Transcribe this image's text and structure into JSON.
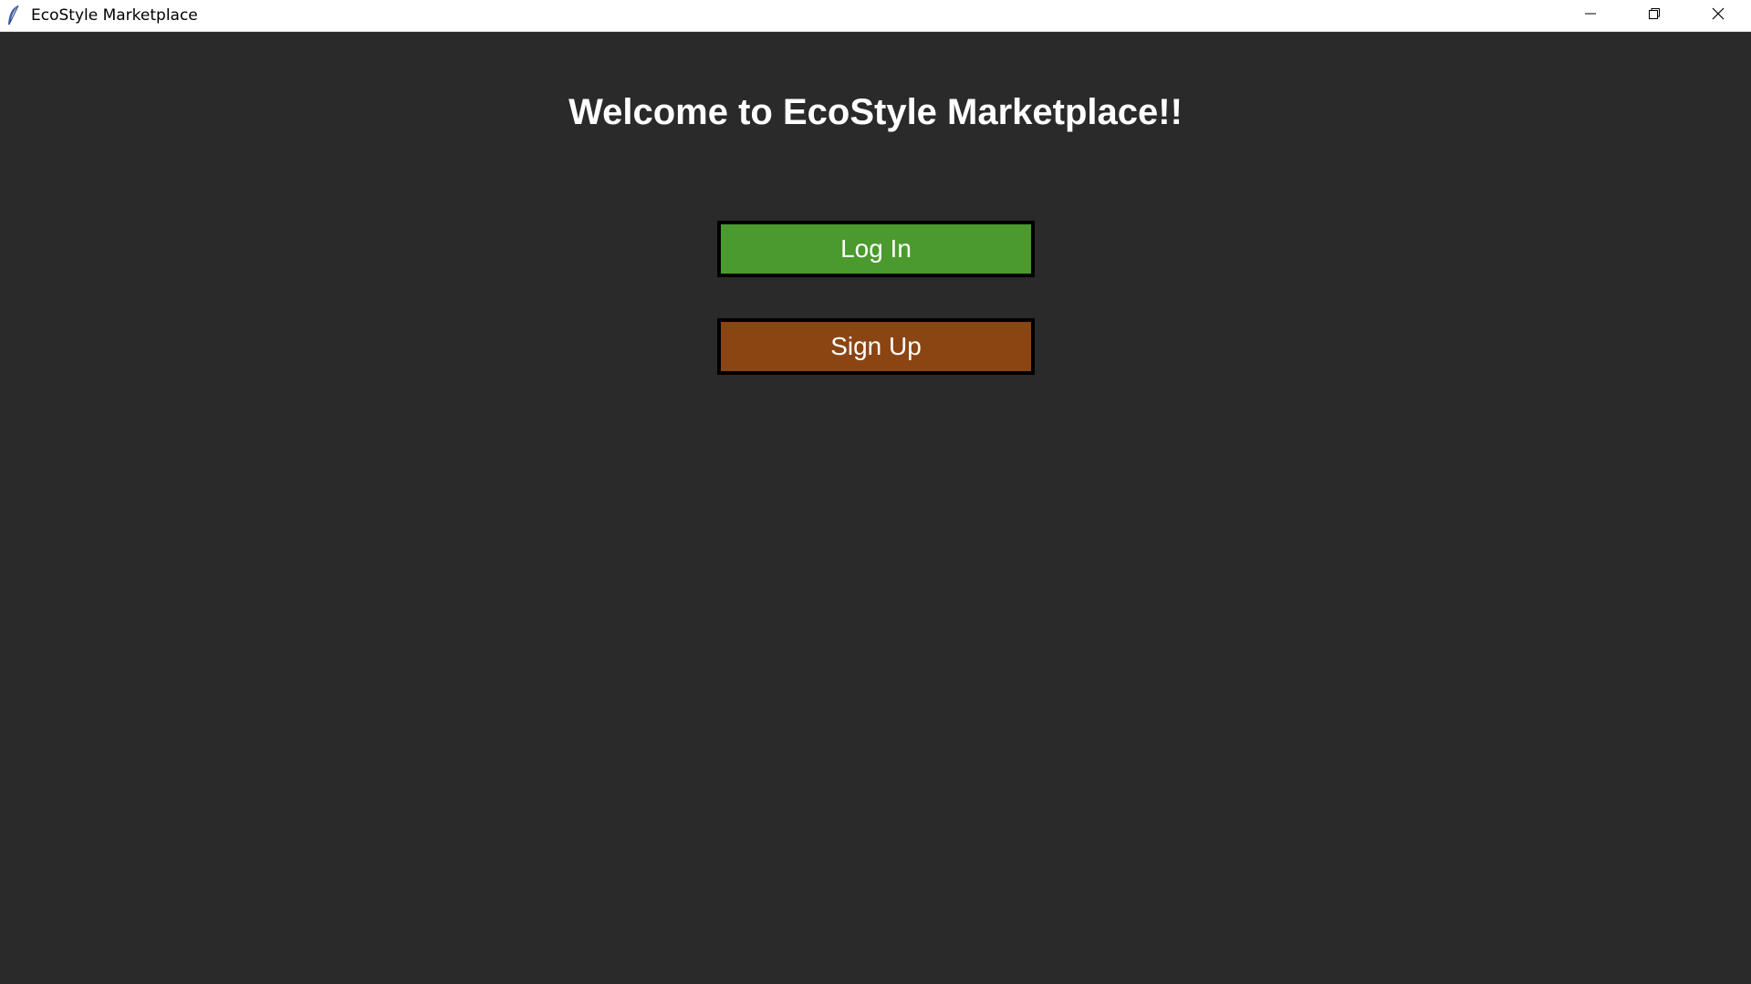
{
  "window": {
    "title": "EcoStyle Marketplace",
    "icon": "feather-icon",
    "controls": [
      "minimize-icon",
      "restore-icon",
      "close-icon"
    ]
  },
  "main": {
    "heading": "Welcome to EcoStyle Marketplace!!",
    "login_label": "Log In",
    "signup_label": "Sign Up"
  },
  "colors": {
    "background": "#2a2a2a",
    "login_button": "#4a9a2e",
    "signup_button": "#8b4513",
    "button_border": "#000000",
    "text": "#ffffff"
  }
}
